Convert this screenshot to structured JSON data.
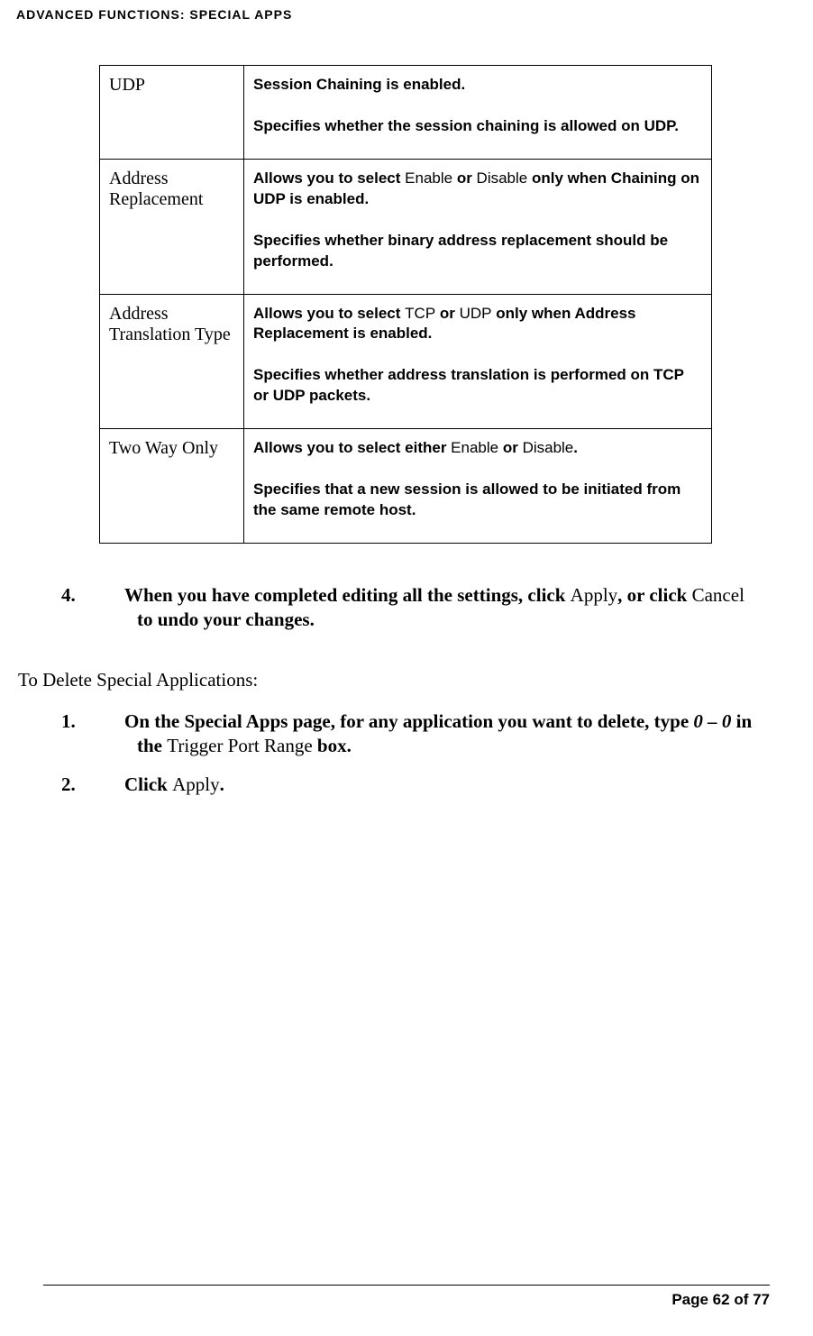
{
  "header": "ADVANCED FUNCTIONS: SPECIAL APPS",
  "table": {
    "rows": [
      {
        "label": "UDP",
        "desc_p1_prefix": "",
        "desc_p1_middle": "",
        "desc_p1_suffix": "Session Chaining is enabled.",
        "desc_p2": "Specifies whether the session chaining is allowed on UDP."
      },
      {
        "label": "Address Replacement",
        "desc_p1_a": "Allows you to select ",
        "desc_p1_b": "Enable",
        "desc_p1_c": " or ",
        "desc_p1_d": "Disable",
        "desc_p1_e": " only when Chaining on UDP is enabled.",
        "desc_p2": "Specifies whether binary address replacement should be performed."
      },
      {
        "label": "Address Translation Type",
        "desc_p1_a": "Allows you to select ",
        "desc_p1_b": "TCP",
        "desc_p1_c": " or ",
        "desc_p1_d": "UDP",
        "desc_p1_e": " only when Address Replacement is enabled.",
        "desc_p2": "Specifies whether address translation is performed on TCP or UDP packets."
      },
      {
        "label": "Two Way Only",
        "desc_p1_a": "Allows you to select either ",
        "desc_p1_b": "Enable",
        "desc_p1_c": " or ",
        "desc_p1_d": "Disable",
        "desc_p1_e": ".",
        "desc_p2": "Specifies that a new session is allowed to be initiated from the same remote host."
      }
    ]
  },
  "step4": {
    "num": "4.",
    "t1": "When you have completed editing all the settings, click ",
    "t2": "Apply",
    "t3": ", or click ",
    "t4": "Cancel",
    "t5": " to undo your changes."
  },
  "subheading": "To Delete Special Applications:",
  "delete_steps": {
    "s1": {
      "num": "1.",
      "t1": "On the Special Apps page, for any application you want to delete, type ",
      "t2": "0 – 0",
      "t3": " in the ",
      "t4": "Trigger Port Range",
      "t5": " box."
    },
    "s2": {
      "num": "2.",
      "t1": "Click ",
      "t2": "Apply",
      "t3": "."
    }
  },
  "footer": "Page 62 of 77"
}
